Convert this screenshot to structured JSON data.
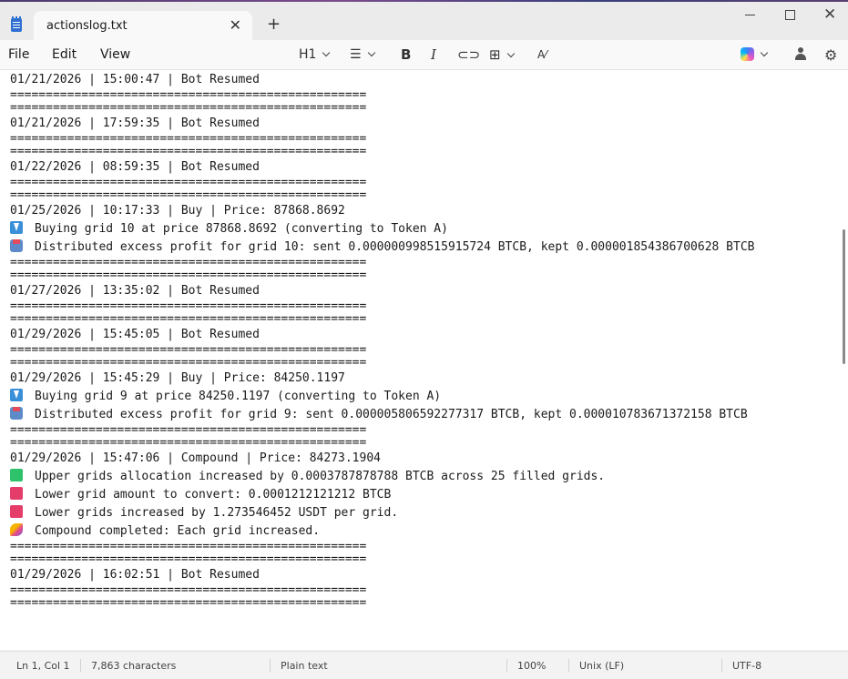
{
  "tab": {
    "title": "actionslog.txt"
  },
  "menu": {
    "file": "File",
    "edit": "Edit",
    "view": "View"
  },
  "toolbar": {
    "heading": "H1"
  },
  "editor": {
    "lines": [
      {
        "text": "01/21/2026 | 15:00:47 | Bot Resumed"
      },
      {
        "text": "==================================================",
        "sep": true
      },
      {
        "text": "==================================================",
        "sep": true
      },
      {
        "text": "01/21/2026 | 17:59:35 | Bot Resumed"
      },
      {
        "text": "==================================================",
        "sep": true
      },
      {
        "text": "==================================================",
        "sep": true
      },
      {
        "text": "01/22/2026 | 08:59:35 | Bot Resumed"
      },
      {
        "text": "==================================================",
        "sep": true
      },
      {
        "text": "==================================================",
        "sep": true
      },
      {
        "text": "01/25/2026 | 10:17:33 | Buy | Price: 87868.8692"
      },
      {
        "text": "Buying grid 10 at price 87868.8692 (converting to Token A)",
        "icon": "down-arrow-icon"
      },
      {
        "text": "Distributed excess profit for grid 10: sent 0.000000998515915724 BTCB, kept 0.000001854386700628 BTCB",
        "icon": "outbox-tray-icon"
      },
      {
        "text": "==================================================",
        "sep": true
      },
      {
        "text": "==================================================",
        "sep": true
      },
      {
        "text": "01/27/2026 | 13:35:02 | Bot Resumed"
      },
      {
        "text": "==================================================",
        "sep": true
      },
      {
        "text": "==================================================",
        "sep": true
      },
      {
        "text": "01/29/2026 | 15:45:05 | Bot Resumed"
      },
      {
        "text": "==================================================",
        "sep": true
      },
      {
        "text": "==================================================",
        "sep": true
      },
      {
        "text": "01/29/2026 | 15:45:29 | Buy | Price: 84250.1197"
      },
      {
        "text": "Buying grid 9 at price 84250.1197 (converting to Token A)",
        "icon": "down-arrow-icon"
      },
      {
        "text": "Distributed excess profit for grid 9: sent 0.000005806592277317 BTCB, kept 0.000010783671372158 BTCB",
        "icon": "outbox-tray-icon"
      },
      {
        "text": "==================================================",
        "sep": true
      },
      {
        "text": "==================================================",
        "sep": true
      },
      {
        "text": "01/29/2026 | 15:47:06 | Compound | Price: 84273.1904"
      },
      {
        "text": "Upper grids allocation increased by 0.0003787878788 BTCB across 25 filled grids.",
        "icon": "green-square-icon"
      },
      {
        "text": "Lower grid amount to convert: 0.0001212121212 BTCB",
        "icon": "red-square-icon"
      },
      {
        "text": "Lower grids increased by 1.273546452 USDT per grid.",
        "icon": "red-square-icon"
      },
      {
        "text": "Compound completed: Each grid increased.",
        "icon": "party-popper-icon"
      },
      {
        "text": "==================================================",
        "sep": true
      },
      {
        "text": "==================================================",
        "sep": true
      },
      {
        "text": "01/29/2026 | 16:02:51 | Bot Resumed"
      },
      {
        "text": "==================================================",
        "sep": true
      },
      {
        "text": "==================================================",
        "sep": true
      }
    ]
  },
  "status": {
    "position": "Ln 1, Col 1",
    "characters": "7,863 characters",
    "format": "Plain text",
    "zoom": "100%",
    "line_ending": "Unix (LF)",
    "encoding": "UTF-8"
  }
}
